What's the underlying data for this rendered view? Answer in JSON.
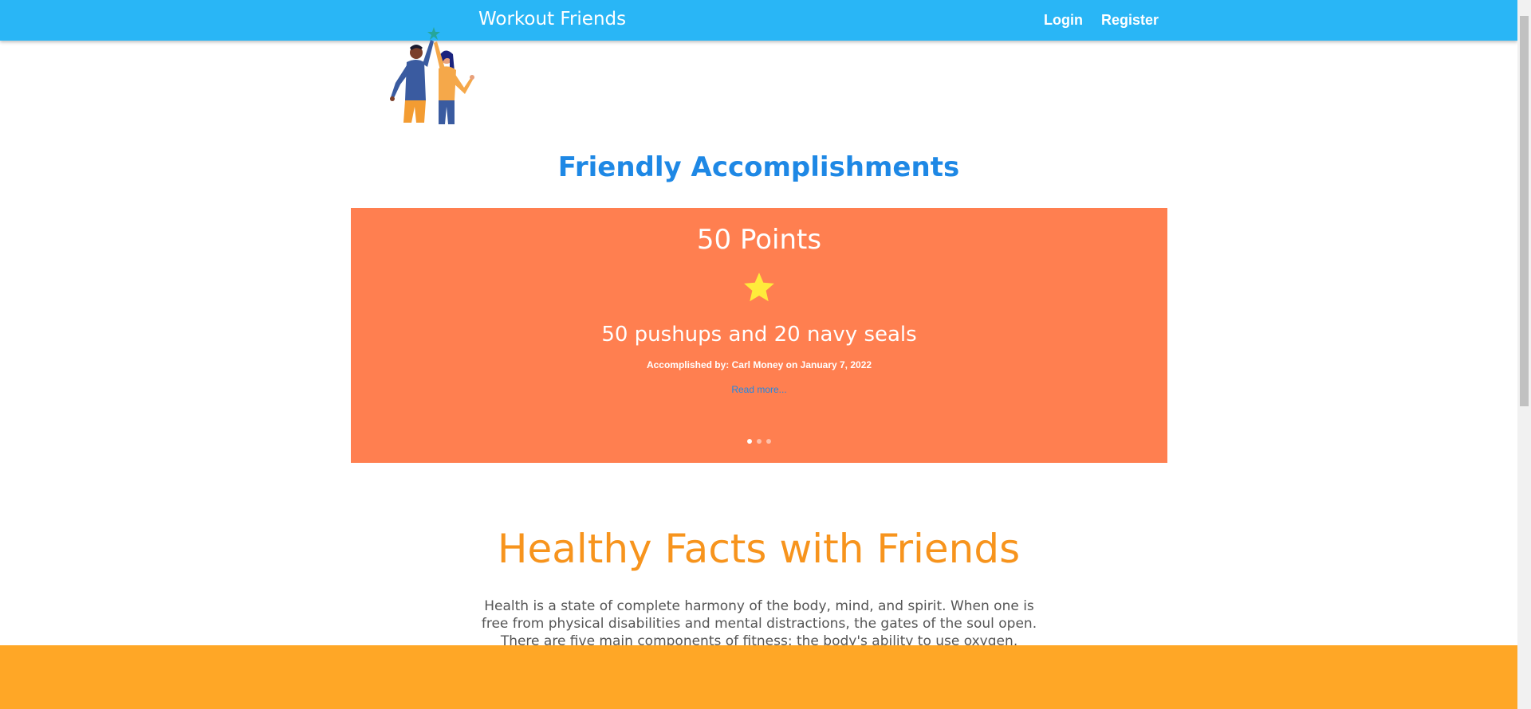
{
  "navbar": {
    "brand": "Workout Friends",
    "links": [
      "Login",
      "Register"
    ],
    "color": "#29b6f6"
  },
  "illustration": {
    "icon": "high-five-friends-illustration"
  },
  "accomplishments": {
    "title": "Friendly Accomplishments",
    "carousel": {
      "background": "#ff7f50",
      "slide": {
        "points": "50 Points",
        "icon": "star-icon",
        "title": "50 pushups and 20 navy seals",
        "accomplished_by": "Accomplished by: Carl Money on January 7, 2022",
        "read_more": "Read more..."
      },
      "slide_count": 3,
      "active_slide": 1
    }
  },
  "facts": {
    "title": "Healthy Facts with Friends",
    "text": "Health is a state of complete harmony of the body, mind, and spirit. When one is free from physical disabilities and mental distractions, the gates of the soul open. There are five main components of fitness: the body's ability to use oxygen, muscular"
  },
  "footer": {
    "color": "#ffa726"
  }
}
